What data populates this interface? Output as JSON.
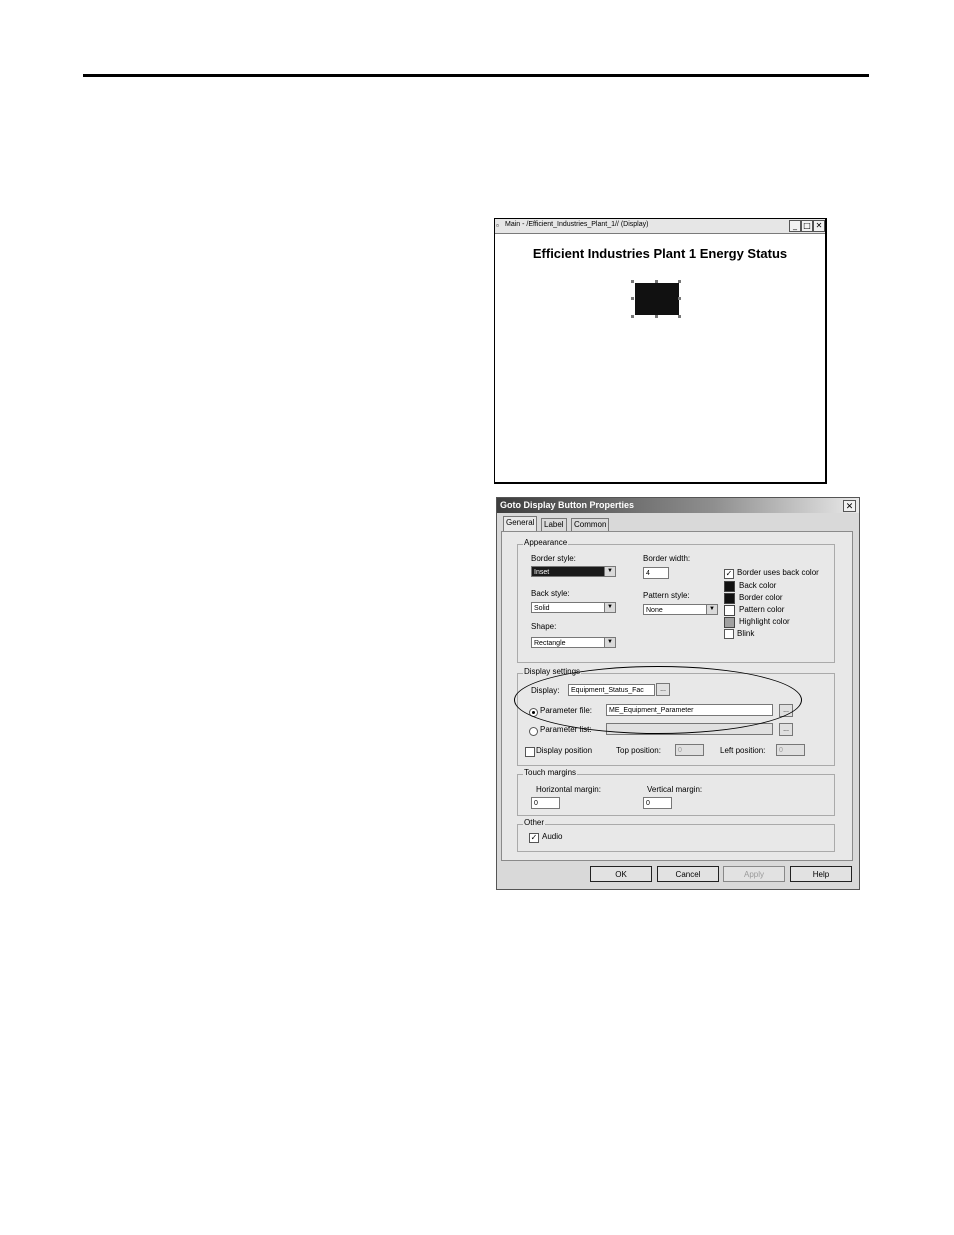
{
  "display_window": {
    "title": "Main - /Efficient_Industries_Plant_1// (Display)",
    "heading": "Efficient Industries Plant 1 Energy Status",
    "controls": {
      "minimize": "_",
      "maximize": "□",
      "close": "✕"
    }
  },
  "dialog": {
    "title": "Goto Display Button Properties",
    "close_glyph": "✕",
    "tabs": [
      "General",
      "Label",
      "Common"
    ],
    "active_tab": "General",
    "appearance": {
      "group_label": "Appearance",
      "border_style_label": "Border style:",
      "border_style_value": "Inset",
      "back_style_label": "Back style:",
      "back_style_value": "Solid",
      "shape_label": "Shape:",
      "shape_value": "Rectangle",
      "border_width_label": "Border width:",
      "border_width_value": "4",
      "pattern_style_label": "Pattern style:",
      "pattern_style_value": "None",
      "border_uses_back_color_label": "Border uses back color",
      "border_uses_back_color_checked": true,
      "colors": [
        {
          "label": "Back color",
          "hex": "#111111"
        },
        {
          "label": "Border color",
          "hex": "#111111"
        },
        {
          "label": "Pattern color",
          "hex": "#ffffff"
        },
        {
          "label": "Highlight color",
          "hex": "#a0a0a0"
        }
      ],
      "blink_label": "Blink",
      "blink_checked": false
    },
    "display_settings": {
      "group_label": "Display settings",
      "display_label": "Display:",
      "display_value": "Equipment_Status_Fac",
      "parameter_file_label": "Parameter file:",
      "parameter_file_value": "ME_Equipment_Parameter",
      "parameter_list_label": "Parameter list:",
      "parameter_list_value": "",
      "display_position_label": "Display position",
      "top_position_label": "Top position:",
      "top_position_value": "0",
      "left_position_label": "Left position:",
      "left_position_value": "0",
      "browse_label": "..."
    },
    "touch_margins": {
      "group_label": "Touch margins",
      "horizontal_label": "Horizontal margin:",
      "horizontal_value": "0",
      "vertical_label": "Vertical margin:",
      "vertical_value": "0"
    },
    "other": {
      "group_label": "Other",
      "audio_label": "Audio",
      "audio_checked": true
    },
    "buttons": {
      "ok": "OK",
      "cancel": "Cancel",
      "apply": "Apply",
      "help": "Help"
    }
  }
}
